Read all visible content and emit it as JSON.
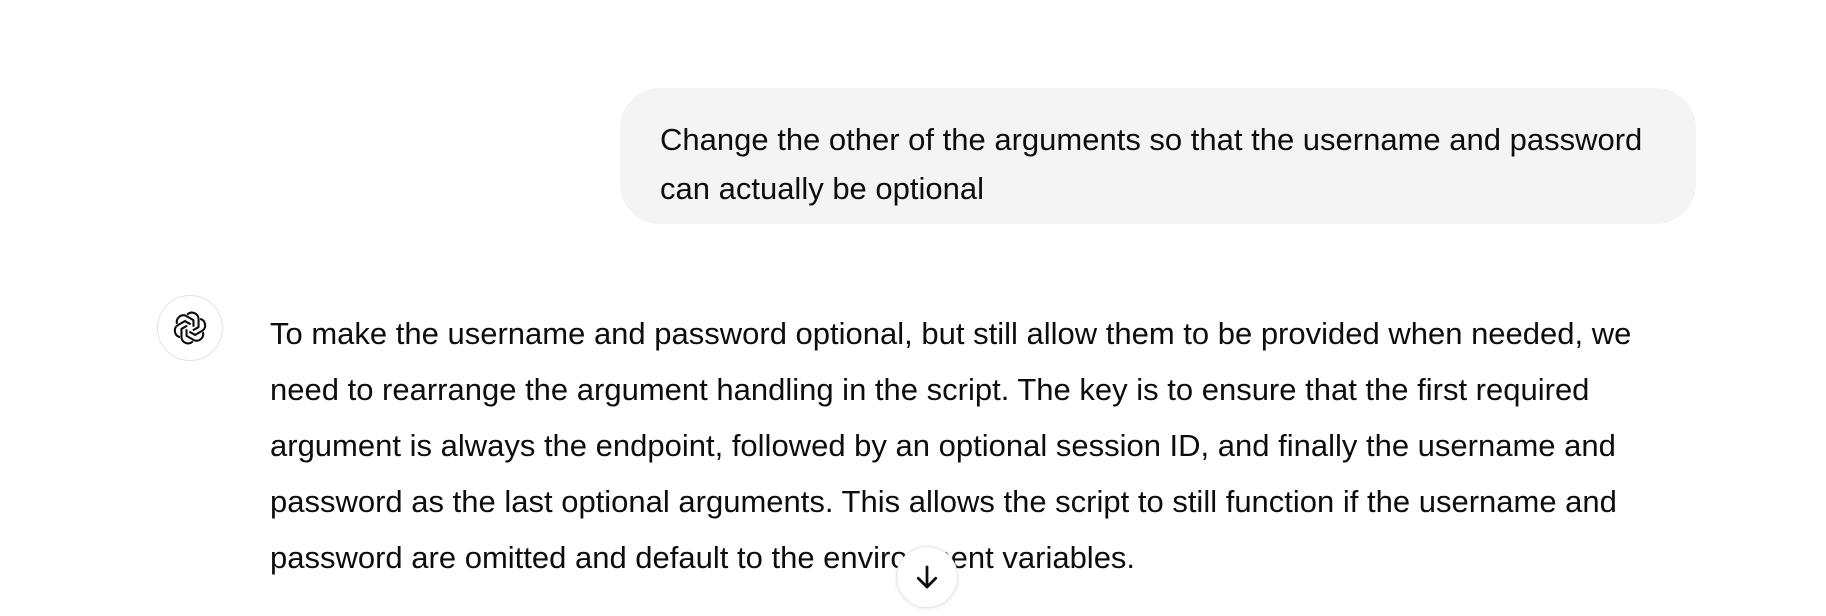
{
  "conversation": {
    "user_message": {
      "text": "Change the other of the arguments so that the username and password can actually be optional"
    },
    "assistant_message": {
      "avatar_icon": "openai-logo-icon",
      "text": "To make the username and password optional, but still allow them to be provided when needed, we need to rearrange the argument handling in the script. The key is to ensure that the first required argument is always the endpoint, followed by an optional session ID, and finally the username and password as the last optional arguments. This allows the script to still function if the username and password are omitted and default to the environment variables."
    }
  },
  "controls": {
    "scroll_down_icon": "arrow-down-icon"
  },
  "colors": {
    "user_bubble_bg": "#f4f4f4",
    "text": "#0d0d0d",
    "border": "#e3e3e3"
  }
}
